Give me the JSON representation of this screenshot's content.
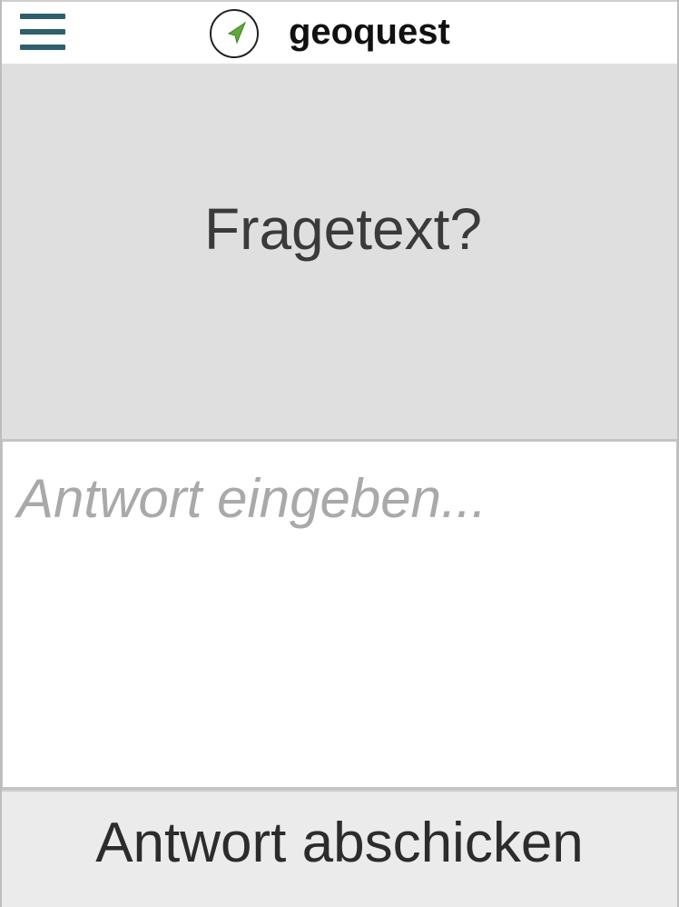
{
  "header": {
    "menu_icon": "hamburger-menu-icon",
    "logo_icon": "compass-arrow-icon",
    "app_title": "geoquest"
  },
  "question": {
    "text": "Fragetext?"
  },
  "answer": {
    "value": "",
    "placeholder": "Antwort eingeben..."
  },
  "submit": {
    "label": "Antwort abschicken"
  },
  "colors": {
    "accent": "#2f5f6b",
    "logo_arrow": "#5fa83a",
    "question_background": "#dfdfdf",
    "button_background": "#ebebeb"
  }
}
